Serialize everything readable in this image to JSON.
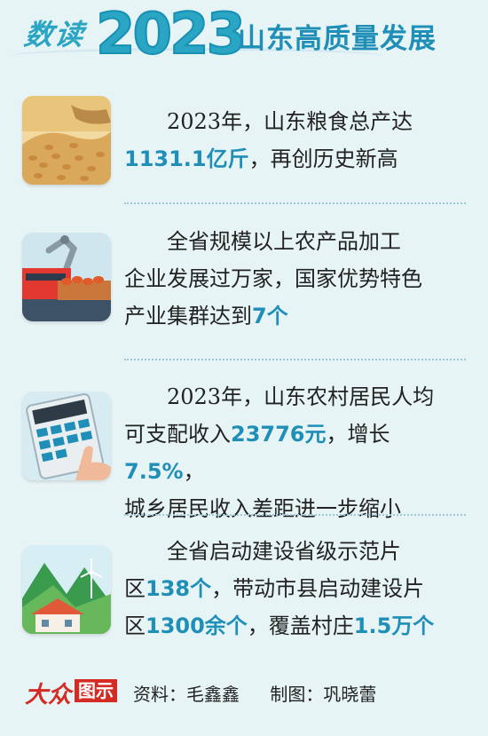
{
  "header": {
    "prefix": "数读",
    "year": "2023",
    "title": "山东高质量发展"
  },
  "items": [
    {
      "icon": "grain-icon",
      "lines": [
        [
          {
            "t": "2023年，山东粮食总产达",
            "h": false
          }
        ],
        [
          {
            "t": "1131.1亿斤",
            "h": true
          },
          {
            "t": "，再创历史新高",
            "h": false
          }
        ]
      ]
    },
    {
      "icon": "factory-robot-icon",
      "lines": [
        [
          {
            "t": "全省规模以上农产品加工",
            "h": false
          }
        ],
        [
          {
            "t": "企业发展过万家，国家优势特色",
            "h": false
          }
        ],
        [
          {
            "t": "产业集群达到",
            "h": false
          },
          {
            "t": "7个",
            "h": true
          }
        ]
      ]
    },
    {
      "icon": "calculator-icon",
      "lines": [
        [
          {
            "t": "2023年，山东农村居民人均",
            "h": false
          }
        ],
        [
          {
            "t": "可支配收入",
            "h": false
          },
          {
            "t": "23776元",
            "h": true
          },
          {
            "t": "，增长",
            "h": false
          },
          {
            "t": "7.5%",
            "h": true
          },
          {
            "t": "，",
            "h": false
          }
        ],
        [
          {
            "t": "城乡居民收入差距进一步缩小",
            "h": false
          }
        ]
      ]
    },
    {
      "icon": "village-windmill-icon",
      "lines": [
        [
          {
            "t": "全省启动建设省级示范片",
            "h": false
          }
        ],
        [
          {
            "t": "区",
            "h": false
          },
          {
            "t": "138个",
            "h": true
          },
          {
            "t": "，带动市县启动建设片",
            "h": false
          }
        ],
        [
          {
            "t": "区",
            "h": false
          },
          {
            "t": "1300余个",
            "h": true
          },
          {
            "t": "，覆盖村庄",
            "h": false
          },
          {
            "t": "1.5万个",
            "h": true
          }
        ]
      ]
    }
  ],
  "footer": {
    "logo_brand": "大众",
    "logo_box": "图示",
    "source": "资料：毛鑫鑫",
    "design": "制图：巩晓蕾"
  },
  "colors": {
    "background": "#e7f4f6",
    "accent": "#1f8fb8",
    "brand_red": "#d52b25"
  }
}
